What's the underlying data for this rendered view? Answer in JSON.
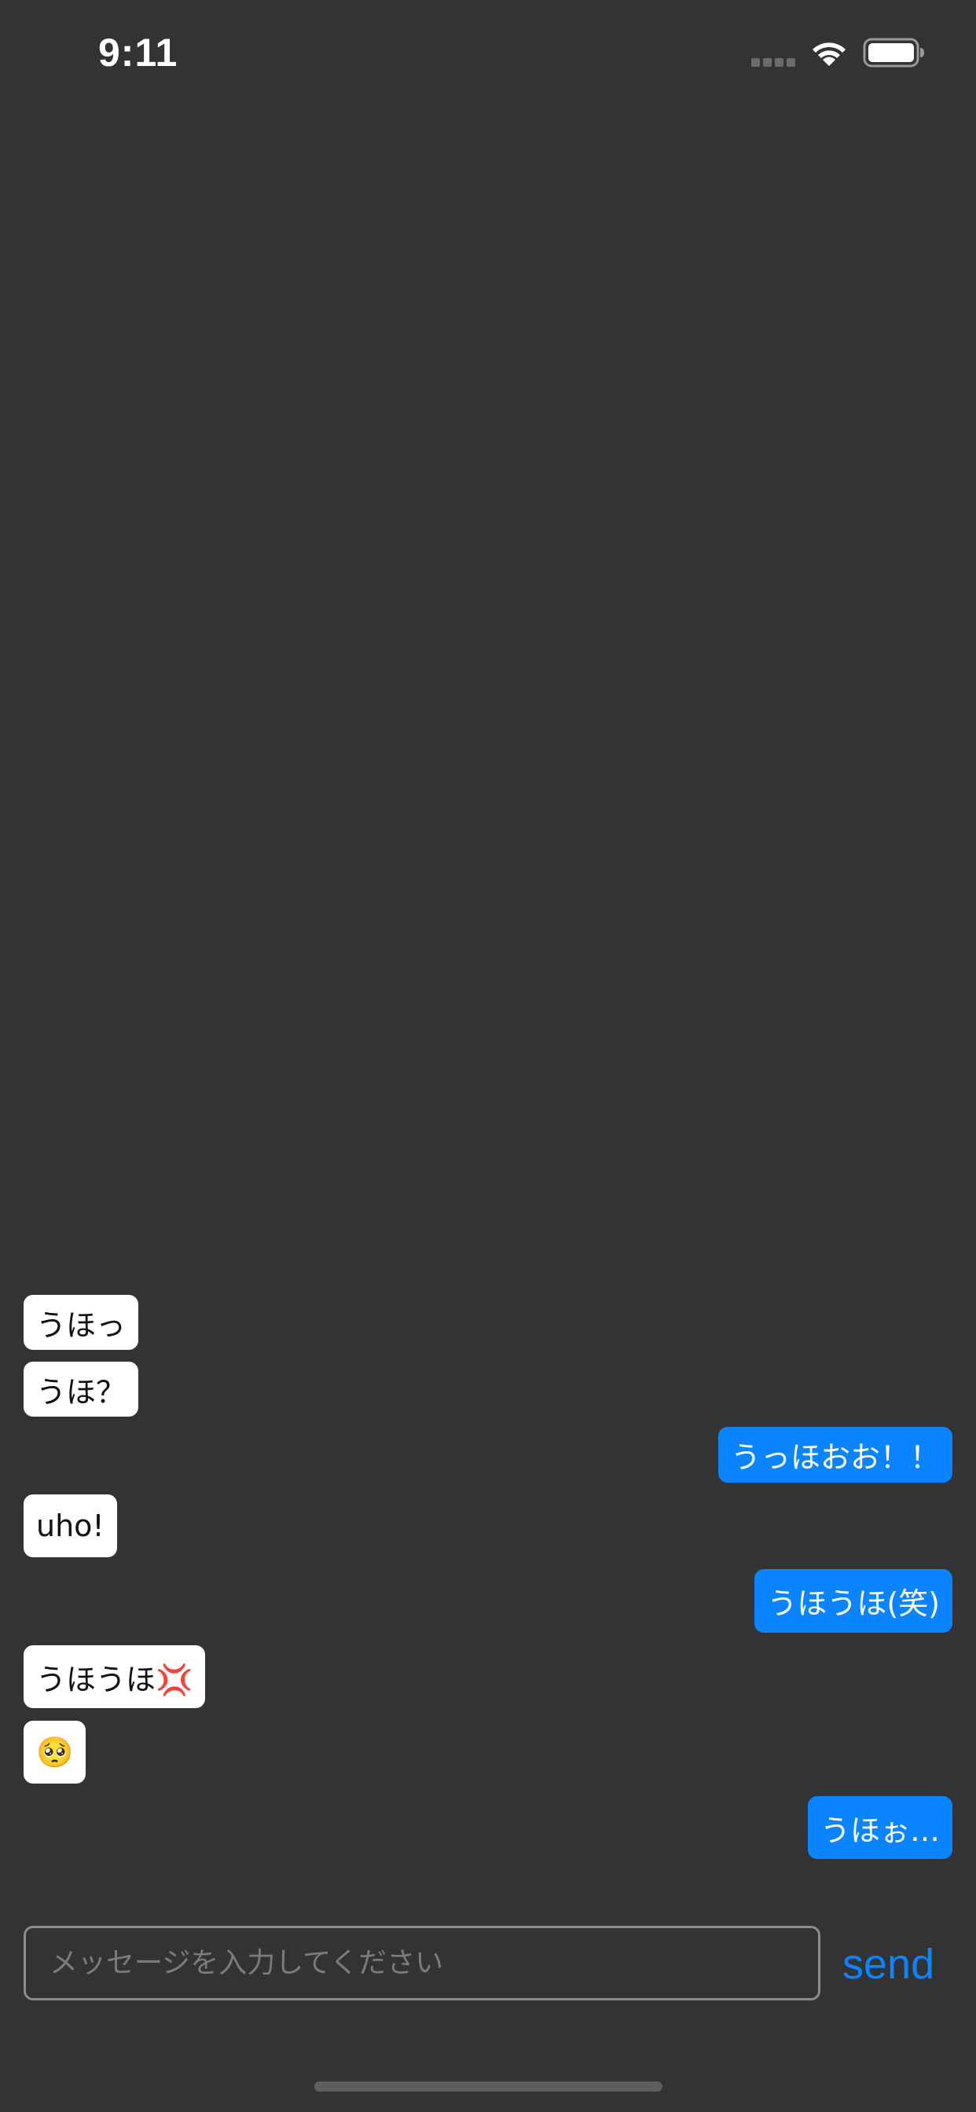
{
  "status_bar": {
    "time": "9:11",
    "icons": [
      "signal-icon",
      "wifi-icon",
      "battery-icon"
    ]
  },
  "colors": {
    "background": "#333333",
    "received_bubble": "#ffffff",
    "sent_bubble": "#0a84ff",
    "accent": "#0a84ff"
  },
  "messages": [
    {
      "text": "うほっ",
      "direction": "received"
    },
    {
      "text": "うほ？",
      "direction": "received"
    },
    {
      "text": "うっほおお！！",
      "direction": "sent"
    },
    {
      "text": "uho!",
      "direction": "received"
    },
    {
      "text": "うほうほ(笑)",
      "direction": "sent"
    },
    {
      "text": "うほうほ💢",
      "direction": "received"
    },
    {
      "text": "🥺",
      "direction": "received"
    },
    {
      "text": "うほぉ…",
      "direction": "sent"
    }
  ],
  "composer": {
    "placeholder": "メッセージを入力してください",
    "value": "",
    "send_label": "send"
  }
}
